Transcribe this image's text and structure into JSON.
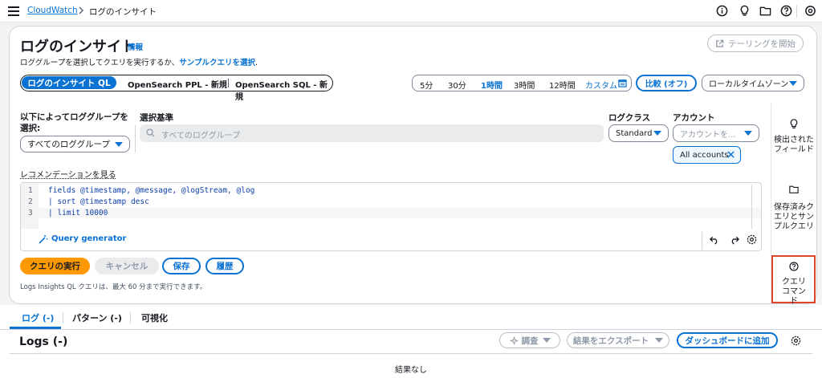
{
  "topbar": {
    "breadcrumb_root": "CloudWatch",
    "breadcrumb_current": "ログのインサイト"
  },
  "header": {
    "title": "ログのインサイト",
    "info": "情報",
    "description_prefix": "ロググループを選択してクエリを実行するか、",
    "description_link": "サンプルクエリを選択",
    "description_suffix": ".",
    "tail_button": "テーリングを開始"
  },
  "query_languages": {
    "active": "ログのインサイト QL",
    "opensearch_ppl": "OpenSearch PPL - 新規",
    "opensearch_sql": "OpenSearch SQL - 新規"
  },
  "time_range": {
    "options": [
      "5分",
      "30分",
      "1時間",
      "3時間",
      "12時間"
    ],
    "custom": "カスタム",
    "selected": "1時間",
    "compare_button": "比較 (オフ)",
    "timezone": "ローカルタイムゾーン"
  },
  "selector": {
    "label": "以下によってロググループを選択:",
    "value": "すべてのロググループ",
    "criteria_label": "選択基準",
    "criteria_placeholder": "すべてのロググループ",
    "log_class_label": "ログクラス",
    "log_class_value": "Standard",
    "account_label": "アカウント",
    "account_placeholder": "アカウントを...",
    "account_token": "All accounts"
  },
  "editor": {
    "recommendations_link": "レコメンデーションを見る",
    "lines": [
      {
        "num": "1",
        "text": "fields @timestamp, @message, @logStream, @log"
      },
      {
        "num": "2",
        "text": "| sort @timestamp desc"
      },
      {
        "num": "3",
        "text": "| limit 10000"
      }
    ],
    "query_generator": "Query generator"
  },
  "actions": {
    "run": "クエリの実行",
    "cancel": "キャンセル",
    "save": "保存",
    "history": "履歴",
    "note": "Logs Insights QL クエリは、最大 60 分まで実行できます。"
  },
  "rightbar": {
    "discovered_fields": "検出されたフィールド",
    "saved_queries": "保存済みクエリとサンプルクエリ",
    "query_commands": "クエリコマンド"
  },
  "results_tabs": {
    "logs": "ログ (-)",
    "patterns": "パターン (-)",
    "visualization": "可視化"
  },
  "logs_section": {
    "title": "Logs (-)",
    "investigate": "調査",
    "export": "結果をエクスポート",
    "add_dashboard": "ダッシュボードに追加",
    "empty_title": "結果なし"
  },
  "colors": {
    "primary": "#0972d3",
    "run_button": "#ff9900",
    "highlight_border": "#e0442a"
  }
}
